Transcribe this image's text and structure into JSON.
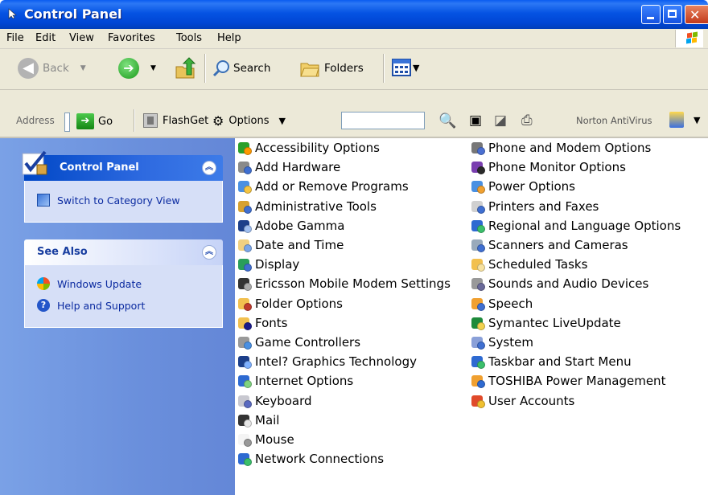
{
  "window": {
    "title": "Control Panel"
  },
  "menu": [
    "File",
    "Edit",
    "View",
    "Favorites",
    "Tools",
    "Help"
  ],
  "toolbar": {
    "back": "Back",
    "search": "Search",
    "folders": "Folders"
  },
  "addressbar": {
    "address_label": "Address",
    "go": "Go",
    "flashget": "FlashGet",
    "options": "Options",
    "norton": "Norton AntiVirus"
  },
  "sidebar": {
    "control_panel_title": "Control Panel",
    "switch_view": "Switch to Category View",
    "see_also_title": "See Also",
    "windows_update": "Windows Update",
    "help_support": "Help and Support"
  },
  "items_left": [
    {
      "label": "Accessibility Options",
      "icon": "accessibility-icon"
    },
    {
      "label": "Add Hardware",
      "icon": "add-hardware-icon"
    },
    {
      "label": "Add or Remove Programs",
      "icon": "add-remove-programs-icon"
    },
    {
      "label": "Administrative Tools",
      "icon": "administrative-tools-icon"
    },
    {
      "label": "Adobe Gamma",
      "icon": "adobe-gamma-icon"
    },
    {
      "label": "Date and Time",
      "icon": "date-time-icon"
    },
    {
      "label": "Display",
      "icon": "display-icon"
    },
    {
      "label": "Ericsson Mobile Modem Settings",
      "icon": "ericsson-modem-icon"
    },
    {
      "label": "Folder Options",
      "icon": "folder-options-icon"
    },
    {
      "label": "Fonts",
      "icon": "fonts-icon"
    },
    {
      "label": "Game Controllers",
      "icon": "game-controllers-icon"
    },
    {
      "label": "Intel? Graphics Technology",
      "icon": "intel-graphics-icon"
    },
    {
      "label": "Internet Options",
      "icon": "internet-options-icon"
    },
    {
      "label": "Keyboard",
      "icon": "keyboard-icon"
    },
    {
      "label": "Mail",
      "icon": "mail-icon"
    },
    {
      "label": "Mouse",
      "icon": "mouse-icon"
    },
    {
      "label": "Network Connections",
      "icon": "network-connections-icon"
    }
  ],
  "items_right": [
    {
      "label": "Phone and Modem Options",
      "icon": "phone-modem-icon"
    },
    {
      "label": "Phone Monitor Options",
      "icon": "phone-monitor-icon"
    },
    {
      "label": "Power Options",
      "icon": "power-options-icon"
    },
    {
      "label": "Printers and Faxes",
      "icon": "printers-faxes-icon"
    },
    {
      "label": "Regional and Language Options",
      "icon": "regional-language-icon"
    },
    {
      "label": "Scanners and Cameras",
      "icon": "scanners-cameras-icon"
    },
    {
      "label": "Scheduled Tasks",
      "icon": "scheduled-tasks-icon"
    },
    {
      "label": "Sounds and Audio Devices",
      "icon": "sounds-audio-icon"
    },
    {
      "label": "Speech",
      "icon": "speech-icon"
    },
    {
      "label": "Symantec LiveUpdate",
      "icon": "symantec-liveupdate-icon"
    },
    {
      "label": "System",
      "icon": "system-icon"
    },
    {
      "label": "Taskbar and Start Menu",
      "icon": "taskbar-start-menu-icon"
    },
    {
      "label": "TOSHIBA Power Management",
      "icon": "toshiba-power-icon"
    },
    {
      "label": "User Accounts",
      "icon": "user-accounts-icon"
    }
  ],
  "colors": {
    "titlebar": "#0053e1",
    "sidebar": "#6f95de",
    "link": "#0a2aa0"
  }
}
